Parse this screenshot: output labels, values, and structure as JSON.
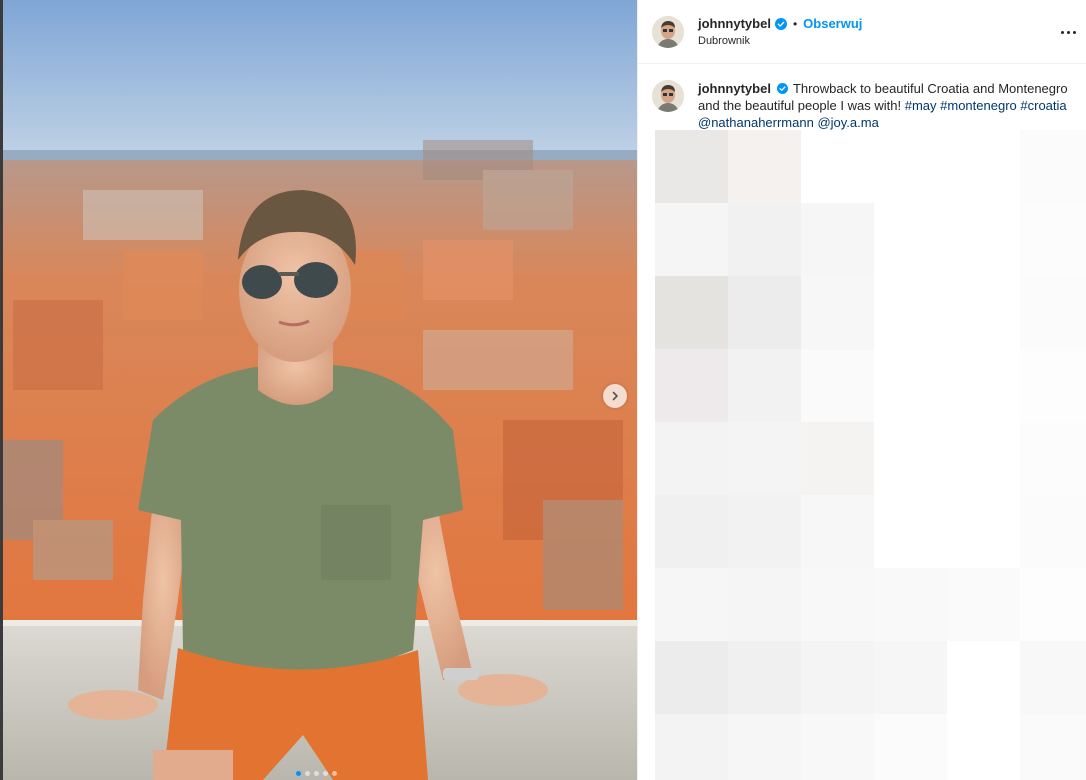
{
  "post": {
    "username": "johnnytybel",
    "follow_label": "Obserwuj",
    "separator": "•",
    "location": "Dubrownik"
  },
  "caption": {
    "username": "johnnytybel",
    "text": "Throwback to beautiful Croatia and Montenegro and the beautiful people I was with!",
    "hashtags": [
      "#may",
      "#montenegro",
      "#croatia"
    ],
    "mentions": [
      "@nathanaherrmann",
      "@joy.a.ma"
    ]
  },
  "carousel": {
    "total": 5,
    "current": 1
  },
  "icons": {
    "verified": "verified-badge-icon",
    "more": "more-options-icon",
    "next": "chevron-right-icon"
  },
  "colors": {
    "accent": "#0095f6",
    "link": "#00376b",
    "text": "#262626"
  }
}
